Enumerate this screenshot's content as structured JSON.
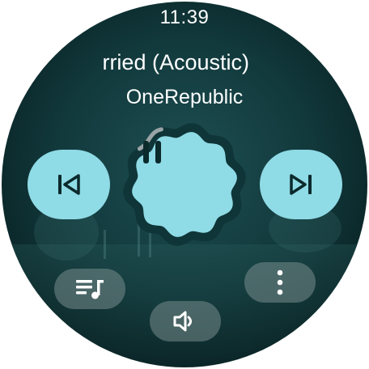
{
  "status": {
    "time": "11:39"
  },
  "now_playing": {
    "title": "rried (Acoustic)",
    "artist": "OneRepublic"
  },
  "controls": {
    "previous": {
      "icon": "skip-previous-icon"
    },
    "play_pause": {
      "icon": "pause-icon",
      "state": "playing",
      "progress": 0.08
    },
    "next": {
      "icon": "skip-next-icon"
    },
    "queue": {
      "icon": "queue-music-icon"
    },
    "volume": {
      "icon": "volume-icon"
    },
    "more": {
      "icon": "more-vertical-icon"
    }
  },
  "colors": {
    "accent": "#8fdbe6",
    "ring": "#0f3538",
    "progress": "#9aa4a6"
  }
}
